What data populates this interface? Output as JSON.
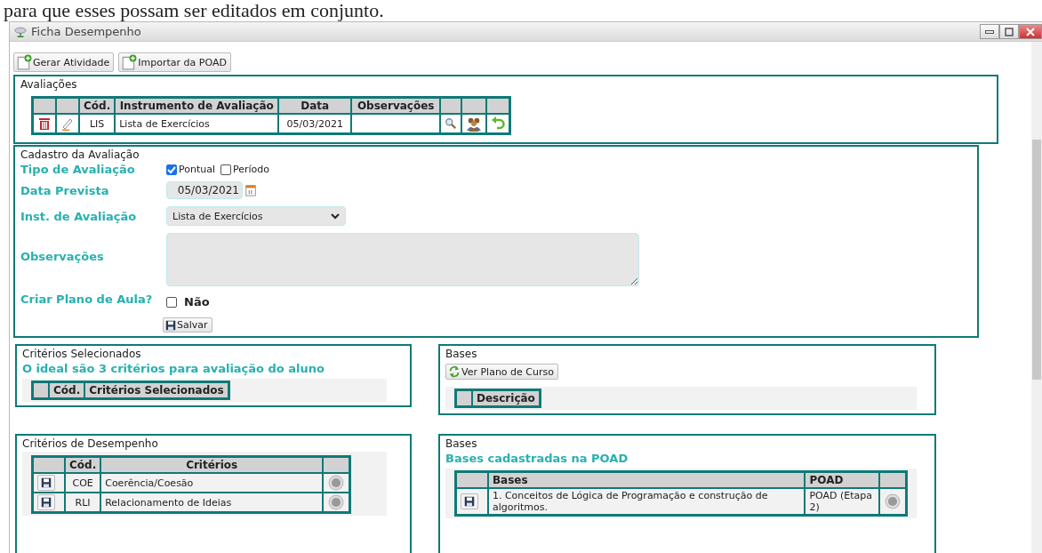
{
  "caption": "para que esses possam ser editados em conjunto.",
  "window": {
    "title": "Ficha Desempenho"
  },
  "toolbar": [
    {
      "label": "Gerar Atividade"
    },
    {
      "label": "Importar da POAD"
    }
  ],
  "avaliacoes": {
    "title": "Avaliações",
    "columns": [
      "Cód.",
      "Instrumento de Avaliação",
      "Data",
      "Observações"
    ],
    "rows": [
      {
        "cod": "LIS",
        "instrumento": "Lista de Exercícios",
        "data": "05/03/2021"
      }
    ]
  },
  "cadastro": {
    "title": "Cadastro da Avaliação",
    "tipo_label": "Tipo de Avaliação",
    "tipo_options": [
      {
        "label": "Pontual",
        "checked": true
      },
      {
        "label": "Período",
        "checked": false
      }
    ],
    "data_label": "Data Prevista",
    "data_value": "05/03/2021",
    "inst_label": "Inst. de Avaliação",
    "inst_value": "Lista de Exercícios",
    "obs_label": "Observações",
    "plano_label": "Criar Plano de Aula?",
    "plano_option": {
      "label": "Não",
      "checked": false
    },
    "save": "Salvar"
  },
  "criterios_selecionados": {
    "title": "Critérios Selecionados",
    "note": "O ideal são 3 critérios para avaliação do aluno",
    "columns": [
      "Cód.",
      "Critérios Selecionados"
    ]
  },
  "bases_top": {
    "title": "Bases",
    "button": "Ver Plano de Curso",
    "columns": [
      "Descrição"
    ]
  },
  "criterios_desempenho": {
    "title": "Critérios de Desempenho",
    "columns": [
      "Cód.",
      "Critérios"
    ],
    "rows": [
      {
        "cod": "COE",
        "criterio": "Coerência/Coesão"
      },
      {
        "cod": "RLI",
        "criterio": "Relacionamento de Ideias"
      }
    ]
  },
  "bases": {
    "title": "Bases",
    "note": "Bases cadastradas na POAD",
    "columns": [
      "Bases",
      "POAD"
    ],
    "rows": [
      {
        "base": "1. Conceitos de Lógica de Programação e construção de algoritmos.",
        "poad": "POAD (Etapa 2)"
      }
    ]
  }
}
